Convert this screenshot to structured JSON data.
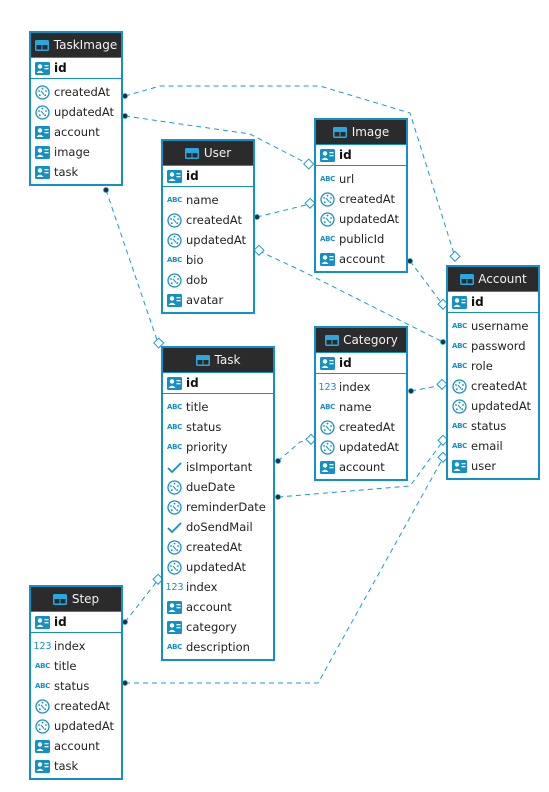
{
  "diagram": {
    "type": "entity-relationship",
    "accent_color": "#1590c6",
    "header_color": "#2b2b2b",
    "entities": {
      "taskimage": {
        "name": "TaskImage",
        "pk": {
          "name": "id",
          "icon": "key-card-icon"
        },
        "attributes": [
          {
            "name": "createdAt",
            "icon": "datetime-icon"
          },
          {
            "name": "updatedAt",
            "icon": "datetime-icon"
          },
          {
            "name": "account",
            "icon": "key-card-icon"
          },
          {
            "name": "image",
            "icon": "key-card-icon"
          },
          {
            "name": "task",
            "icon": "key-card-icon"
          }
        ]
      },
      "user": {
        "name": "User",
        "pk": {
          "name": "id",
          "icon": "key-card-icon"
        },
        "attributes": [
          {
            "name": "name",
            "icon": "text-icon"
          },
          {
            "name": "createdAt",
            "icon": "datetime-icon"
          },
          {
            "name": "updatedAt",
            "icon": "datetime-icon"
          },
          {
            "name": "bio",
            "icon": "text-icon"
          },
          {
            "name": "dob",
            "icon": "datetime-icon"
          },
          {
            "name": "avatar",
            "icon": "key-card-icon"
          }
        ]
      },
      "image": {
        "name": "Image",
        "pk": {
          "name": "id",
          "icon": "key-card-icon"
        },
        "attributes": [
          {
            "name": "url",
            "icon": "text-icon"
          },
          {
            "name": "createdAt",
            "icon": "datetime-icon"
          },
          {
            "name": "updatedAt",
            "icon": "datetime-icon"
          },
          {
            "name": "publicId",
            "icon": "text-icon"
          },
          {
            "name": "account",
            "icon": "key-card-icon"
          }
        ]
      },
      "account": {
        "name": "Account",
        "pk": {
          "name": "id",
          "icon": "key-card-icon"
        },
        "attributes": [
          {
            "name": "username",
            "icon": "text-icon"
          },
          {
            "name": "password",
            "icon": "text-icon"
          },
          {
            "name": "role",
            "icon": "text-icon"
          },
          {
            "name": "createdAt",
            "icon": "datetime-icon"
          },
          {
            "name": "updatedAt",
            "icon": "datetime-icon"
          },
          {
            "name": "status",
            "icon": "text-icon"
          },
          {
            "name": "email",
            "icon": "text-icon"
          },
          {
            "name": "user",
            "icon": "key-card-icon"
          }
        ]
      },
      "category": {
        "name": "Category",
        "pk": {
          "name": "id",
          "icon": "key-card-icon"
        },
        "attributes": [
          {
            "name": "index",
            "icon": "number-icon"
          },
          {
            "name": "name",
            "icon": "text-icon"
          },
          {
            "name": "createdAt",
            "icon": "datetime-icon"
          },
          {
            "name": "updatedAt",
            "icon": "datetime-icon"
          },
          {
            "name": "account",
            "icon": "key-card-icon"
          }
        ]
      },
      "task": {
        "name": "Task",
        "pk": {
          "name": "id",
          "icon": "key-card-icon"
        },
        "attributes": [
          {
            "name": "title",
            "icon": "text-icon"
          },
          {
            "name": "status",
            "icon": "text-icon"
          },
          {
            "name": "priority",
            "icon": "text-icon"
          },
          {
            "name": "isImportant",
            "icon": "check-icon"
          },
          {
            "name": "dueDate",
            "icon": "datetime-icon"
          },
          {
            "name": "reminderDate",
            "icon": "datetime-icon"
          },
          {
            "name": "doSendMail",
            "icon": "check-icon"
          },
          {
            "name": "createdAt",
            "icon": "datetime-icon"
          },
          {
            "name": "updatedAt",
            "icon": "datetime-icon"
          },
          {
            "name": "index",
            "icon": "number-icon"
          },
          {
            "name": "account",
            "icon": "key-card-icon"
          },
          {
            "name": "category",
            "icon": "key-card-icon"
          },
          {
            "name": "description",
            "icon": "text-icon"
          }
        ]
      },
      "step": {
        "name": "Step",
        "pk": {
          "name": "id",
          "icon": "key-card-icon"
        },
        "attributes": [
          {
            "name": "index",
            "icon": "number-icon"
          },
          {
            "name": "title",
            "icon": "text-icon"
          },
          {
            "name": "status",
            "icon": "text-icon"
          },
          {
            "name": "createdAt",
            "icon": "datetime-icon"
          },
          {
            "name": "updatedAt",
            "icon": "datetime-icon"
          },
          {
            "name": "account",
            "icon": "key-card-icon"
          },
          {
            "name": "task",
            "icon": "key-card-icon"
          }
        ]
      }
    },
    "relationships": [
      {
        "from": "TaskImage",
        "to": "Account"
      },
      {
        "from": "TaskImage",
        "to": "Image"
      },
      {
        "from": "TaskImage",
        "to": "Task"
      },
      {
        "from": "User",
        "to": "Image"
      },
      {
        "from": "User",
        "to": "Account"
      },
      {
        "from": "Image",
        "to": "Account"
      },
      {
        "from": "Category",
        "to": "Account"
      },
      {
        "from": "Task",
        "to": "Category"
      },
      {
        "from": "Task",
        "to": "Account"
      },
      {
        "from": "Step",
        "to": "Task"
      },
      {
        "from": "Step",
        "to": "Account"
      }
    ]
  }
}
